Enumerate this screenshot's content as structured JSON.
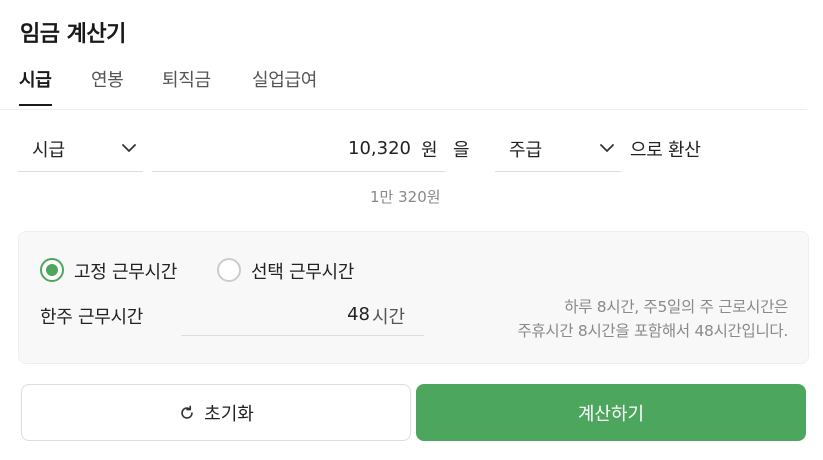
{
  "header": {
    "title": "임금 계산기"
  },
  "tabs": [
    {
      "label": "시급",
      "active": true
    },
    {
      "label": "연봉",
      "active": false
    },
    {
      "label": "퇴직금",
      "active": false
    },
    {
      "label": "실업급여",
      "active": false
    }
  ],
  "converter": {
    "from_unit": "시급",
    "amount": "10,320",
    "currency": "원",
    "particle": "을",
    "to_unit": "주급",
    "suffix": "으로 환산",
    "amount_hint": "1만 320원"
  },
  "work_hours": {
    "options": [
      {
        "label": "고정 근무시간",
        "checked": true
      },
      {
        "label": "선택 근무시간",
        "checked": false
      }
    ],
    "weekly_label": "한주 근무시간",
    "weekly_value": "48",
    "weekly_unit": "시간",
    "note_line1": "하루 8시간, 주5일의 주 근로시간은",
    "note_line2": "주휴시간 8시간을 포함해서 48시간입니다."
  },
  "actions": {
    "reset_label": "초기화",
    "calculate_label": "계산하기"
  },
  "colors": {
    "accent": "#4ca65e",
    "muted_text": "#888888",
    "panel_bg": "#f8f8f8"
  },
  "icons": {
    "dropdown": "chevron-down-icon",
    "reset": "refresh-icon"
  }
}
